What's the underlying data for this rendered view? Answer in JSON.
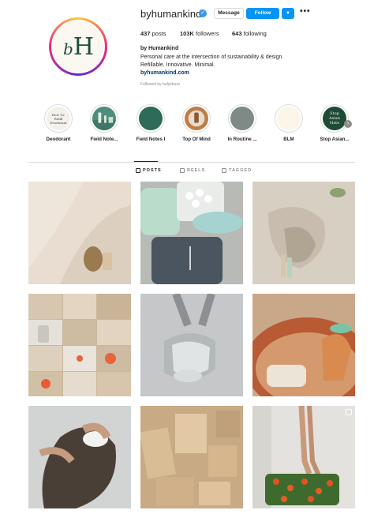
{
  "profile": {
    "username": "byhumankind",
    "avatar_logo": "bH",
    "message_label": "Message",
    "follow_label": "Follow",
    "stats": {
      "posts": "437",
      "posts_label": "posts",
      "followers": "103K",
      "followers_label": "followers",
      "following": "643",
      "following_label": "following"
    },
    "bio_name": "by Humankind",
    "bio_lines": [
      "Personal care at the intersection of sustainability & design.",
      "Refillable. Innovative. Minimal."
    ],
    "link": "byhumankind.com",
    "followed_by": "Followed by ladykbuzz"
  },
  "highlights": [
    {
      "label": "Deodorant",
      "cover_text": "How To: Refill Deodorant",
      "color": "#f4f1ea"
    },
    {
      "label": "Field Note...",
      "cover_text": "",
      "color": "#4f8e7c"
    },
    {
      "label": "Field Notes I",
      "cover_text": "",
      "color": "#2e6b58"
    },
    {
      "label": "Top Of Mind",
      "cover_text": "",
      "color": "#c07c46"
    },
    {
      "label": "In Routine ...",
      "cover_text": "",
      "color": "#7d8a86"
    },
    {
      "label": "BLM",
      "cover_text": "",
      "color": "#fbf6e8"
    },
    {
      "label": "Stop Asian...",
      "cover_text": "Stop Asian Hate",
      "color": "#1f4a36"
    }
  ],
  "tabs": {
    "posts": "POSTS",
    "reels": "REELS",
    "tagged": "TAGGED"
  },
  "colors": {
    "accent": "#0095f6",
    "brand_green": "#1f4f3e",
    "link": "#00376b"
  },
  "icons": {
    "verified": "verified-badge-icon",
    "more": "more-options-icon",
    "dropdown": "chevron-down-icon"
  }
}
